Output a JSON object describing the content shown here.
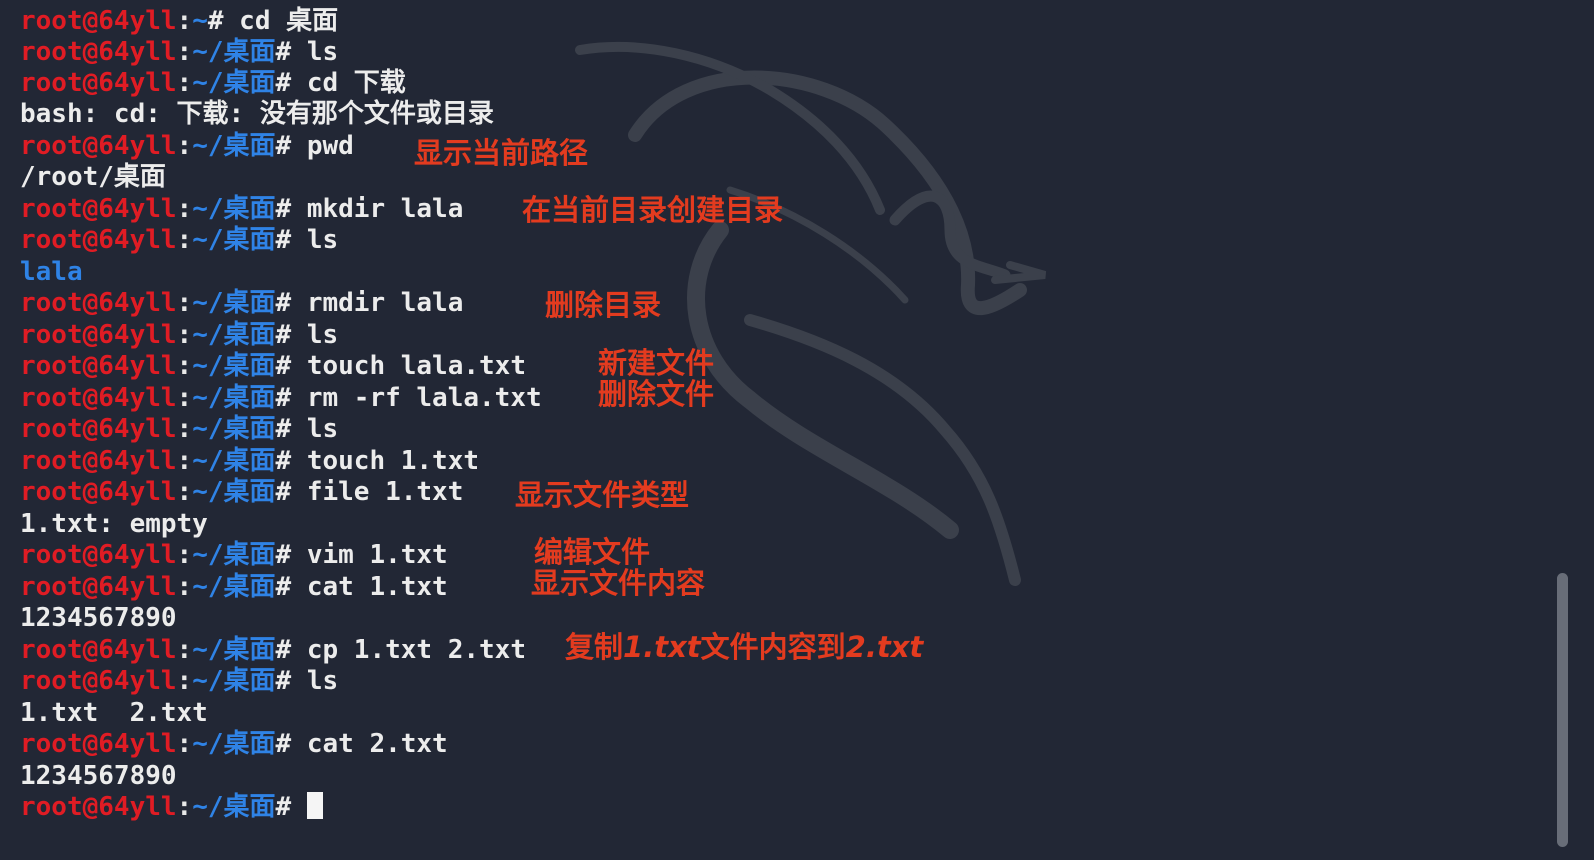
{
  "terminal": {
    "lines": [
      {
        "prompt": "root@64yll",
        "sep": ":",
        "path": "~",
        "hash": "#",
        "cmd": " cd 桌面"
      },
      {
        "prompt": "root@64yll",
        "sep": ":",
        "path": "~/桌面",
        "hash": "#",
        "cmd": " ls"
      },
      {
        "prompt": "root@64yll",
        "sep": ":",
        "path": "~/桌面",
        "hash": "#",
        "cmd": " cd 下载"
      },
      {
        "output": "bash: cd: 下载: 没有那个文件或目录"
      },
      {
        "prompt": "root@64yll",
        "sep": ":",
        "path": "~/桌面",
        "hash": "#",
        "cmd": " pwd"
      },
      {
        "output": "/root/桌面"
      },
      {
        "prompt": "root@64yll",
        "sep": ":",
        "path": "~/桌面",
        "hash": "#",
        "cmd": " mkdir lala"
      },
      {
        "prompt": "root@64yll",
        "sep": ":",
        "path": "~/桌面",
        "hash": "#",
        "cmd": " ls"
      },
      {
        "dir_output": "lala"
      },
      {
        "prompt": "root@64yll",
        "sep": ":",
        "path": "~/桌面",
        "hash": "#",
        "cmd": " rmdir lala"
      },
      {
        "prompt": "root@64yll",
        "sep": ":",
        "path": "~/桌面",
        "hash": "#",
        "cmd": " ls"
      },
      {
        "prompt": "root@64yll",
        "sep": ":",
        "path": "~/桌面",
        "hash": "#",
        "cmd": " touch lala.txt"
      },
      {
        "prompt": "root@64yll",
        "sep": ":",
        "path": "~/桌面",
        "hash": "#",
        "cmd": " rm -rf lala.txt"
      },
      {
        "prompt": "root@64yll",
        "sep": ":",
        "path": "~/桌面",
        "hash": "#",
        "cmd": " ls"
      },
      {
        "prompt": "root@64yll",
        "sep": ":",
        "path": "~/桌面",
        "hash": "#",
        "cmd": " touch 1.txt"
      },
      {
        "prompt": "root@64yll",
        "sep": ":",
        "path": "~/桌面",
        "hash": "#",
        "cmd": " file 1.txt"
      },
      {
        "output": "1.txt: empty"
      },
      {
        "prompt": "root@64yll",
        "sep": ":",
        "path": "~/桌面",
        "hash": "#",
        "cmd": " vim 1.txt"
      },
      {
        "prompt": "root@64yll",
        "sep": ":",
        "path": "~/桌面",
        "hash": "#",
        "cmd": " cat 1.txt"
      },
      {
        "output": "1234567890"
      },
      {
        "prompt": "root@64yll",
        "sep": ":",
        "path": "~/桌面",
        "hash": "#",
        "cmd": " cp 1.txt 2.txt"
      },
      {
        "prompt": "root@64yll",
        "sep": ":",
        "path": "~/桌面",
        "hash": "#",
        "cmd": " ls"
      },
      {
        "output": "1.txt  2.txt"
      },
      {
        "prompt": "root@64yll",
        "sep": ":",
        "path": "~/桌面",
        "hash": "#",
        "cmd": " cat 2.txt"
      },
      {
        "output": "1234567890"
      },
      {
        "prompt": "root@64yll",
        "sep": ":",
        "path": "~/桌面",
        "hash": "#",
        "cmd": " ",
        "cursor": true
      }
    ]
  },
  "annotations": {
    "pwd": "显示当前路径",
    "mkdir": "在当前目录创建目录",
    "rmdir": "删除目录",
    "touch": "新建文件",
    "rm": "删除文件",
    "file": "显示文件类型",
    "vim": "编辑文件",
    "cat": "显示文件内容",
    "cp_prefix": "复制",
    "cp_file1": "1.txt",
    "cp_middle": "文件内容到",
    "cp_file2": "2.txt"
  },
  "colors": {
    "background": "#222735",
    "prompt_user": "#e01c24",
    "prompt_path": "#2f83e6",
    "text": "#ececec",
    "annotation": "#e33b1f",
    "scrollbar": "#7a7f89"
  },
  "icons": {
    "watermark": "kali-dragon-icon",
    "cursor": "block-cursor-icon"
  }
}
